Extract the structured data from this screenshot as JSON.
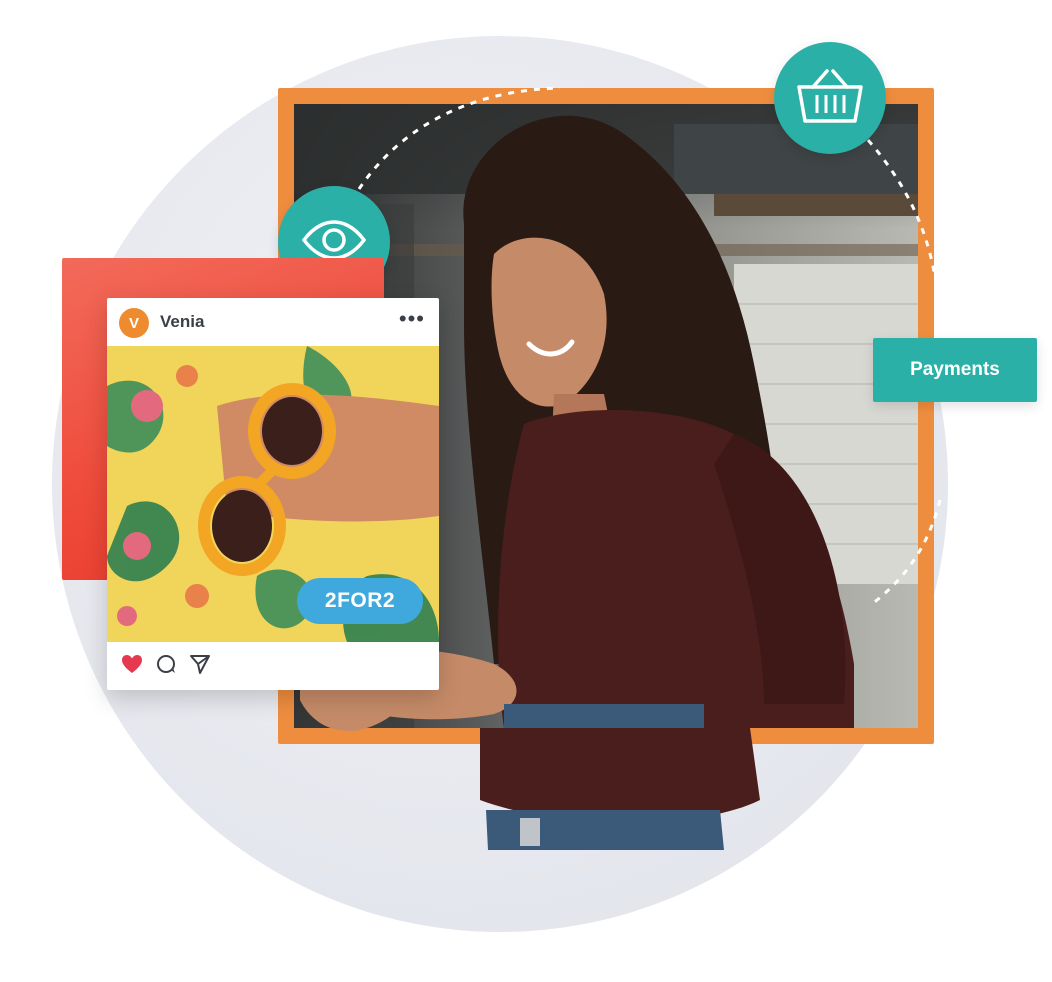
{
  "post": {
    "avatar_letter": "V",
    "username": "Venia",
    "more_label": "•••",
    "promo_code": "2FOR2"
  },
  "payments_label": "Payments",
  "icons": {
    "eye": "eye-icon",
    "basket": "basket-icon",
    "heart": "heart-icon",
    "comment": "comment-icon",
    "share": "send-icon"
  },
  "colors": {
    "teal": "#2bb0a7",
    "orange": "#ef8d3f",
    "red": "#ef4b3b",
    "promo_blue": "#3fa9dd",
    "heart": "#e53950"
  }
}
